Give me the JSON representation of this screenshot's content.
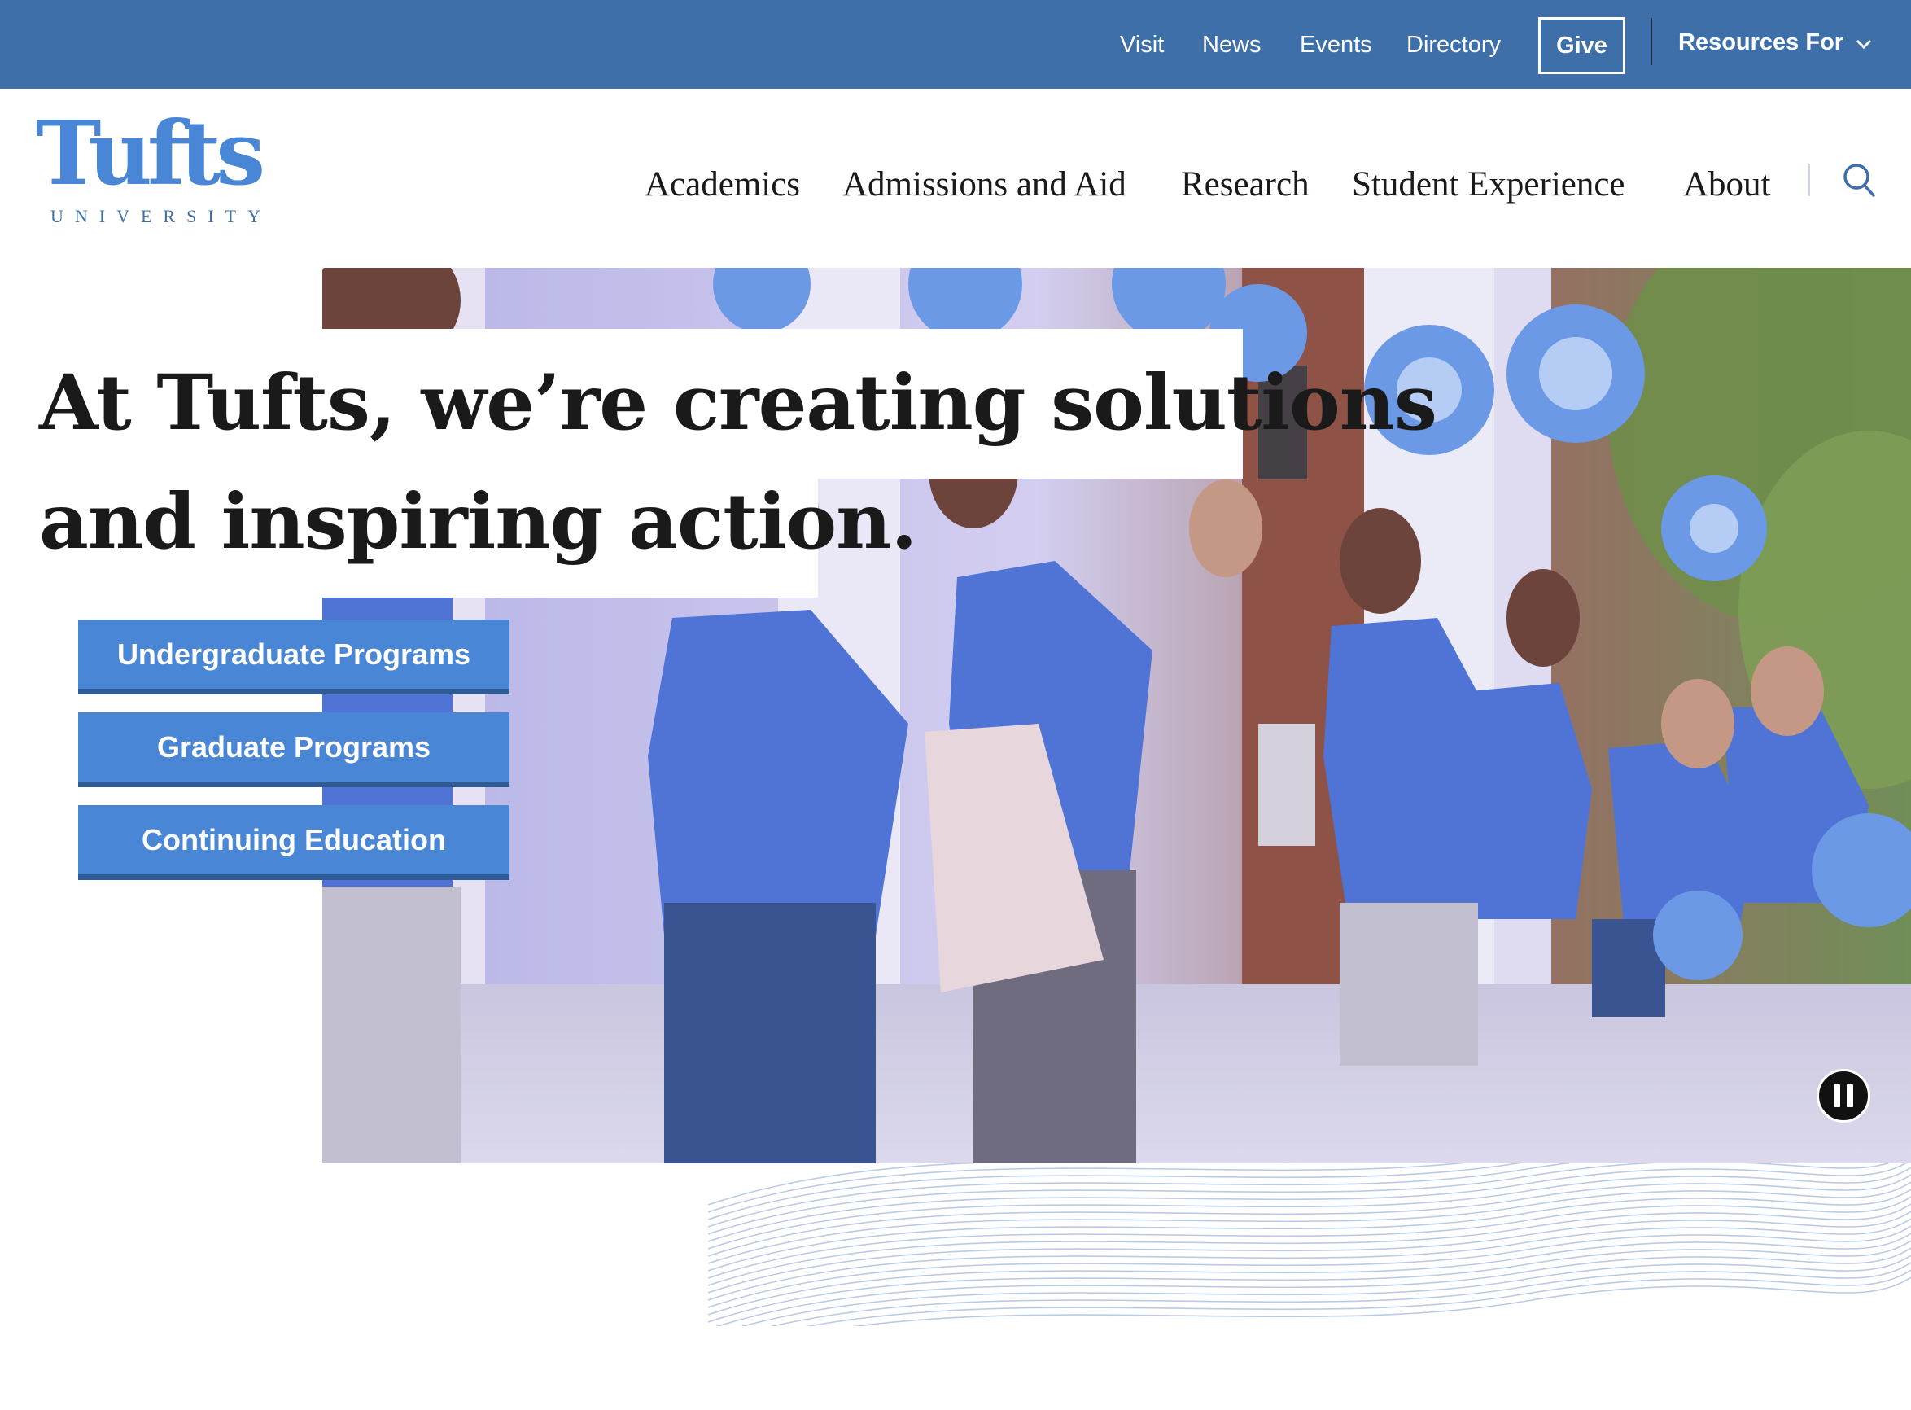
{
  "utility_nav": {
    "links": [
      "Visit",
      "News",
      "Events",
      "Directory"
    ],
    "give_label": "Give",
    "resources_label": "Resources For"
  },
  "logo": {
    "wordmark": "Tufts",
    "subtitle": "UNIVERSITY"
  },
  "main_nav": {
    "items": [
      "Academics",
      "Admissions and Aid",
      "Research",
      "Student Experience",
      "About"
    ]
  },
  "hero": {
    "headline_line1": "At Tufts, we’re creating solutions",
    "headline_line2": "and inspiring action.",
    "buttons": [
      "Undergraduate Programs",
      "Graduate Programs",
      "Continuing Education"
    ]
  },
  "icons": {
    "search": "search-icon",
    "chevron": "chevron-down-icon",
    "pause": "pause-icon"
  },
  "colors": {
    "utility_bar": "#3e6fa9",
    "brand_blue": "#4a86d6",
    "button_shadow": "#2f5c94",
    "text": "#1a1a1a"
  }
}
